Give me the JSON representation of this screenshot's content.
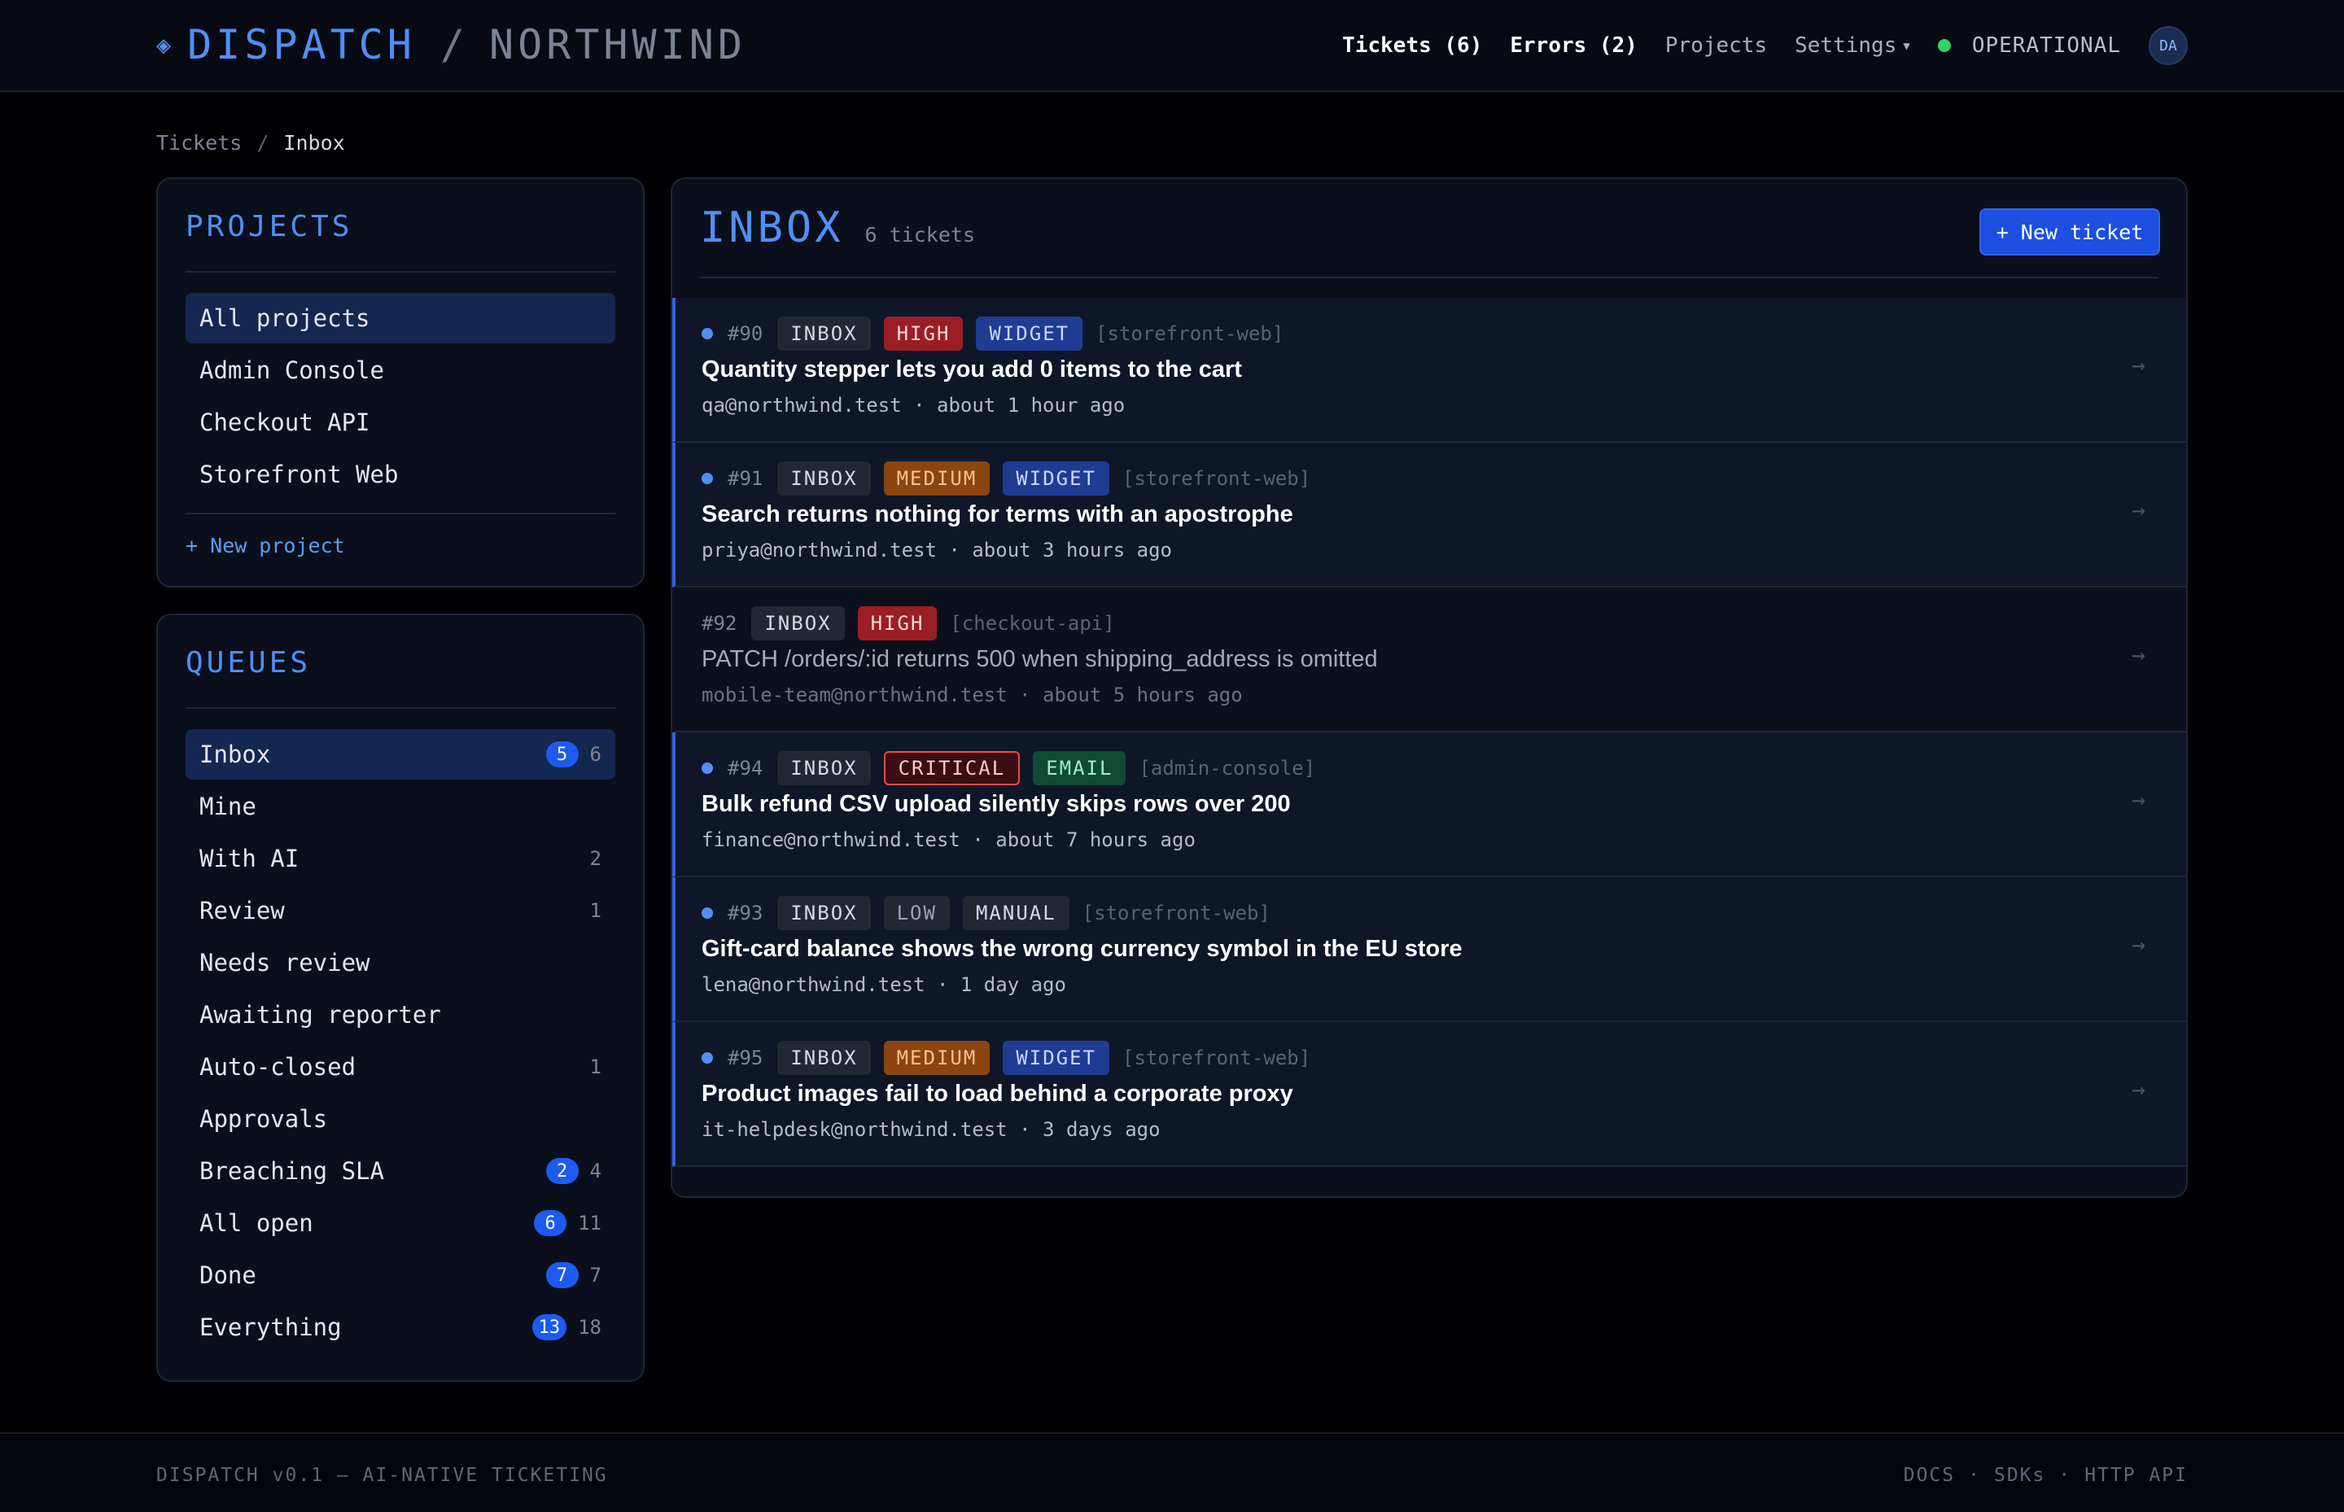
{
  "header": {
    "brand_icon": "◈",
    "brand": "DISPATCH",
    "separator": "/",
    "org": "NORTHWIND",
    "nav": {
      "tickets": "Tickets (6)",
      "errors": "Errors (2)",
      "projects": "Projects",
      "settings": "Settings"
    },
    "status": "OPERATIONAL",
    "status_color": "#2bd663",
    "avatar": "DA"
  },
  "breadcrumb": {
    "root": "Tickets",
    "sep": "/",
    "current": "Inbox"
  },
  "projects_panel": {
    "title": "PROJECTS",
    "items": [
      {
        "label": "All projects"
      },
      {
        "label": "Admin Console"
      },
      {
        "label": "Checkout API"
      },
      {
        "label": "Storefront Web"
      }
    ],
    "new_project": "+ New project"
  },
  "queues_panel": {
    "title": "QUEUES",
    "items": [
      {
        "label": "Inbox",
        "badge": "5",
        "count": "6"
      },
      {
        "label": "Mine",
        "badge": "",
        "count": ""
      },
      {
        "label": "With AI",
        "badge": "",
        "count": "2"
      },
      {
        "label": "Review",
        "badge": "",
        "count": "1"
      },
      {
        "label": "Needs review",
        "badge": "",
        "count": ""
      },
      {
        "label": "Awaiting reporter",
        "badge": "",
        "count": ""
      },
      {
        "label": "Auto-closed",
        "badge": "",
        "count": "1"
      },
      {
        "label": "Approvals",
        "badge": "",
        "count": ""
      },
      {
        "label": "Breaching SLA",
        "badge": "2",
        "count": "4"
      },
      {
        "label": "All open",
        "badge": "6",
        "count": "11"
      },
      {
        "label": "Done",
        "badge": "7",
        "count": "7"
      },
      {
        "label": "Everything",
        "badge": "13",
        "count": "18"
      }
    ]
  },
  "main": {
    "title": "INBOX",
    "subtitle": "6 tickets",
    "new_ticket": "+ New ticket",
    "arrow": "→",
    "tickets": [
      {
        "num": "#90",
        "status": "INBOX",
        "priority": "HIGH",
        "channel": "WIDGET",
        "project": "[storefront-web]",
        "title": "Quantity stepper lets you add 0 items to the cart",
        "reporter": "qa@northwind.test",
        "time": "about 1 hour ago"
      },
      {
        "num": "#91",
        "status": "INBOX",
        "priority": "MEDIUM",
        "channel": "WIDGET",
        "project": "[storefront-web]",
        "title": "Search returns nothing for terms with an apostrophe",
        "reporter": "priya@northwind.test",
        "time": "about 3 hours ago"
      },
      {
        "num": "#92",
        "status": "INBOX",
        "priority": "HIGH",
        "channel": "",
        "project": "[checkout-api]",
        "title": "PATCH /orders/:id returns 500 when shipping_address is omitted",
        "reporter": "mobile-team@northwind.test",
        "time": "about 5 hours ago"
      },
      {
        "num": "#94",
        "status": "INBOX",
        "priority": "CRITICAL",
        "channel": "EMAIL",
        "project": "[admin-console]",
        "title": "Bulk refund CSV upload silently skips rows over 200",
        "reporter": "finance@northwind.test",
        "time": "about 7 hours ago"
      },
      {
        "num": "#93",
        "status": "INBOX",
        "priority": "LOW",
        "channel": "MANUAL",
        "project": "[storefront-web]",
        "title": "Gift-card balance shows the wrong currency symbol in the EU store",
        "reporter": "lena@northwind.test",
        "time": "1 day ago"
      },
      {
        "num": "#95",
        "status": "INBOX",
        "priority": "MEDIUM",
        "channel": "WIDGET",
        "project": "[storefront-web]",
        "title": "Product images fail to load behind a corporate proxy",
        "reporter": "it-helpdesk@northwind.test",
        "time": "3 days ago"
      }
    ]
  },
  "footer": {
    "left": "DISPATCH v0.1 — AI-NATIVE TICKETING",
    "links": [
      "DOCS",
      "SDKs",
      "HTTP API"
    ],
    "sep": "·"
  },
  "colors": {
    "accent": "#4f8ff7",
    "high": "#9a1e24",
    "medium": "#8a4510",
    "critical_border": "#f04a4a",
    "widget": "#1f3c93",
    "email": "#0f4a34"
  }
}
